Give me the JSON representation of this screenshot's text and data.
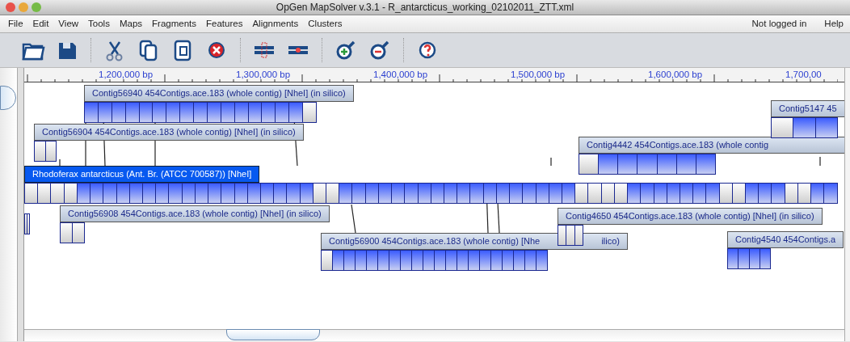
{
  "window": {
    "title": "OpGen MapSolver v.3.1 - R_antarcticus_working_02102011_ZTT.xml"
  },
  "menus": [
    {
      "label": "File"
    },
    {
      "label": "Edit"
    },
    {
      "label": "View"
    },
    {
      "label": "Tools"
    },
    {
      "label": "Maps"
    },
    {
      "label": "Fragments"
    },
    {
      "label": "Features"
    },
    {
      "label": "Alignments"
    },
    {
      "label": "Clusters"
    }
  ],
  "login_status": "Not logged in",
  "help_menu": "Help",
  "ruler": {
    "labels": [
      "1,200,000 bp",
      "1,300,000 bp",
      "1,400,000 bp",
      "1,500,000 bp",
      "1,600,000 bp",
      "1,700,00"
    ]
  },
  "maps": [
    {
      "label": "Contig56940 454Contigs.ace.183 (whole contig) [NheI] (in silico)",
      "selected": false,
      "fragments": [
        {
          "aligned": true
        },
        {
          "aligned": true
        },
        {
          "aligned": true
        },
        {
          "aligned": true
        },
        {
          "aligned": true
        },
        {
          "aligned": true
        },
        {
          "aligned": true
        },
        {
          "aligned": true
        },
        {
          "aligned": true
        },
        {
          "aligned": true
        },
        {
          "aligned": true
        },
        {
          "aligned": true
        },
        {
          "aligned": true
        },
        {
          "aligned": true
        },
        {
          "aligned": true
        },
        {
          "aligned": true
        },
        {
          "aligned": false
        }
      ]
    },
    {
      "label": "Contig5147 45",
      "selected": false,
      "fragments": [
        {
          "aligned": false
        },
        {
          "aligned": true
        },
        {
          "aligned": true
        }
      ]
    },
    {
      "label": "Contig56904 454Contigs.ace.183 (whole contig) [NheI] (in silico)",
      "selected": false,
      "fragments": [
        {
          "aligned": false
        },
        {
          "aligned": false
        }
      ]
    },
    {
      "label": "Contig4442 454Contigs.ace.183 (whole contig",
      "selected": false,
      "fragments": [
        {
          "aligned": false
        },
        {
          "aligned": true
        },
        {
          "aligned": true
        },
        {
          "aligned": true
        },
        {
          "aligned": true
        },
        {
          "aligned": true
        },
        {
          "aligned": true
        }
      ]
    },
    {
      "label": "Rhodoferax antarcticus (Ant. Br. (ATCC 700587)) [NheI]",
      "selected": true,
      "fragments": [
        {
          "aligned": false
        },
        {
          "aligned": false
        },
        {
          "aligned": false
        },
        {
          "aligned": false
        },
        {
          "aligned": true
        },
        {
          "aligned": true
        },
        {
          "aligned": true
        },
        {
          "aligned": true
        },
        {
          "aligned": true
        },
        {
          "aligned": true
        },
        {
          "aligned": true
        },
        {
          "aligned": true
        },
        {
          "aligned": true
        },
        {
          "aligned": true
        },
        {
          "aligned": true
        },
        {
          "aligned": true
        },
        {
          "aligned": true
        },
        {
          "aligned": true
        },
        {
          "aligned": true
        },
        {
          "aligned": true
        },
        {
          "aligned": true
        },
        {
          "aligned": true
        },
        {
          "aligned": false
        },
        {
          "aligned": false
        },
        {
          "aligned": true
        },
        {
          "aligned": true
        },
        {
          "aligned": true
        },
        {
          "aligned": true
        },
        {
          "aligned": true
        },
        {
          "aligned": true
        },
        {
          "aligned": true
        },
        {
          "aligned": true
        },
        {
          "aligned": true
        },
        {
          "aligned": true
        },
        {
          "aligned": true
        },
        {
          "aligned": true
        },
        {
          "aligned": true
        },
        {
          "aligned": true
        },
        {
          "aligned": true
        },
        {
          "aligned": true
        },
        {
          "aligned": true
        },
        {
          "aligned": true
        },
        {
          "aligned": false
        },
        {
          "aligned": false
        },
        {
          "aligned": false
        },
        {
          "aligned": false
        },
        {
          "aligned": true
        },
        {
          "aligned": true
        },
        {
          "aligned": true
        },
        {
          "aligned": true
        },
        {
          "aligned": true
        },
        {
          "aligned": true
        },
        {
          "aligned": true
        },
        {
          "aligned": false
        },
        {
          "aligned": false
        },
        {
          "aligned": true
        },
        {
          "aligned": true
        },
        {
          "aligned": true
        },
        {
          "aligned": false
        },
        {
          "aligned": false
        },
        {
          "aligned": true
        },
        {
          "aligned": true
        }
      ]
    },
    {
      "label": "Contig56908 454Contigs.ace.183 (whole contig) [NheI] (in silico)",
      "selected": false,
      "fragments": [
        {
          "aligned": false
        },
        {
          "aligned": false
        }
      ]
    },
    {
      "label": "Contig4650 454Contigs.ace.183 (whole contig) [NheI] (in silico)",
      "selected": false,
      "fragments": [
        {
          "aligned": false
        },
        {
          "aligned": false
        },
        {
          "aligned": false
        }
      ]
    },
    {
      "label": "Contig56900 454Contigs.ace.183 (whole contig) [Nhe",
      "label_end": "ilico)",
      "selected": false,
      "fragments": [
        {
          "aligned": false
        },
        {
          "aligned": true
        },
        {
          "aligned": true
        },
        {
          "aligned": true
        },
        {
          "aligned": true
        },
        {
          "aligned": true
        },
        {
          "aligned": true
        },
        {
          "aligned": true
        },
        {
          "aligned": true
        },
        {
          "aligned": true
        },
        {
          "aligned": true
        },
        {
          "aligned": true
        },
        {
          "aligned": true
        },
        {
          "aligned": true
        },
        {
          "aligned": true
        },
        {
          "aligned": true
        },
        {
          "aligned": true
        },
        {
          "aligned": true
        },
        {
          "aligned": true
        },
        {
          "aligned": true
        }
      ]
    },
    {
      "label": "Contig4540 454Contigs.a",
      "selected": false,
      "fragments": [
        {
          "aligned": true
        },
        {
          "aligned": true
        },
        {
          "aligned": true
        },
        {
          "aligned": true
        }
      ]
    },
    {
      "fragments": [
        {
          "aligned": false
        },
        {
          "aligned": false
        }
      ]
    }
  ]
}
